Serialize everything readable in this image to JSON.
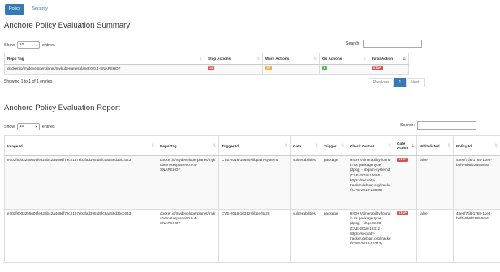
{
  "colors": {
    "accent": "#337ab7",
    "stop": "#d9534f",
    "warn": "#f0ad4e",
    "go": "#5cb85c"
  },
  "nav": {
    "tabs": [
      {
        "label": "Policy",
        "active": true
      },
      {
        "label": "Security",
        "active": false
      }
    ]
  },
  "summary": {
    "title": "Anchore Policy Evaluation Summary",
    "show_label": "Show",
    "entries_label": "entries",
    "page_size": "10",
    "search_label": "Search:",
    "columns": [
      "Repo Tag",
      "Stop Actions",
      "Warn Actions",
      "Go Actions",
      "Final Action"
    ],
    "row": {
      "repo_tag": "docker.io/mydeveloperplanet/mykubernetesplanet:0.0.4-SNAPSHOT",
      "stop": "14",
      "warn": "37",
      "go": "6",
      "final": "STOP"
    },
    "info": "Showing 1 to 1 of 1 entries",
    "pagination": {
      "previous": "Previous",
      "page": "1",
      "next": "Next"
    }
  },
  "report": {
    "title": "Anchore Policy Evaluation Report",
    "show_label": "Show",
    "entries_label": "entries",
    "page_size": "10",
    "search_label": "Search:",
    "columns": [
      "Image Id",
      "Repo Tag",
      "Trigger Id",
      "Gate",
      "Trigger",
      "Check Output",
      "Gate Action",
      "Whitelisted",
      "Policy Id"
    ],
    "rows": [
      {
        "image_id": "e702f8b03255609fe328b42a469df79c2137eb3fad395fd9fc5aa59d3bcc043",
        "repo_tag": "docker.io/mydeveloperplanet/mykubernetesplanet:0.0.4-SNAPSHOT",
        "trigger_id": "CVE-2018-15686+libpam-systemd",
        "gate": "vulnerabilities",
        "trigger": "package",
        "check_output": "HIGH Vulnerability found in os package type (dpkg) - libpam-systemd (CVE-2018-15686 - https://security-tracker.debian.org/tracker/CVE-2018-15686)",
        "gate_action": "STOP",
        "whitelisted": "false",
        "policy_id": "48e6f7d8-1765-11e8-b5f9-8b6f228548b6"
      },
      {
        "image_id": "e702f8b03255609fe328b42a469df79c2137eb3fad395fd9fc5aa59d3bcc043",
        "repo_tag": "docker.io/mydeveloperplanet/mykubernetesplanet:0.0.4-SNAPSHOT",
        "trigger_id": "CVE-2018-16312+libperl5.28",
        "gate": "vulnerabilities",
        "trigger": "package",
        "check_output": "HIGH Vulnerability found in os package type (dpkg) - libperl5.28 (CVE-2018-16312 - https://security-tracker.debian.org/tracker/CVE-2018-16312)",
        "gate_action": "STOP",
        "whitelisted": "false",
        "policy_id": "48e6f7d8-1765-11e8-b5f9-8b6f228548b6"
      }
    ]
  }
}
